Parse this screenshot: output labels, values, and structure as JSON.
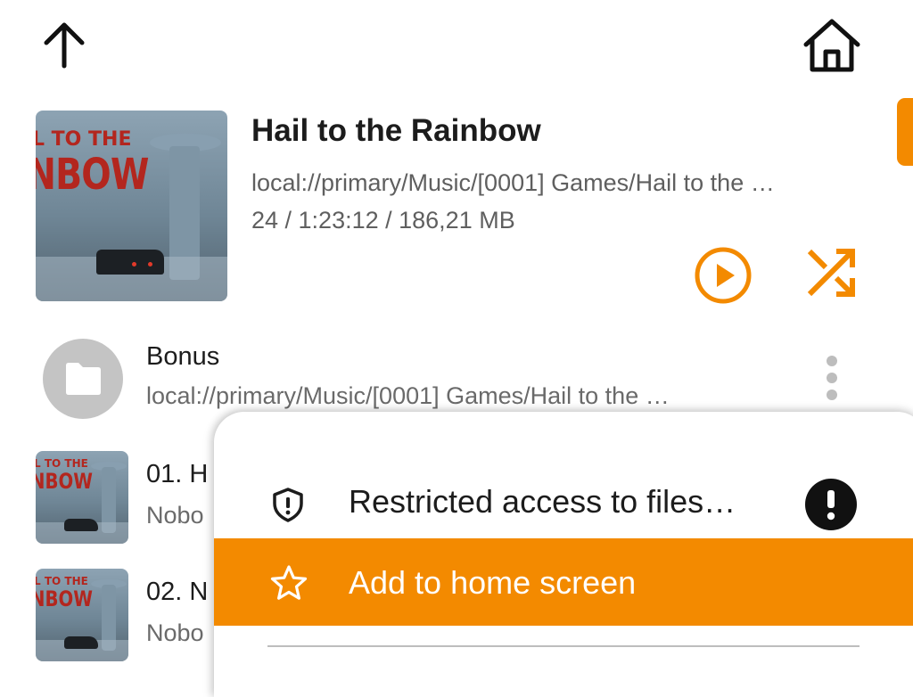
{
  "colors": {
    "accent": "#f38a00",
    "folder_avatar": "#c4c4c4"
  },
  "toolbar": {
    "up_icon": "arrow-up-icon",
    "home_icon": "home-icon"
  },
  "album": {
    "title": "Hail to the Rainbow",
    "path": "local://primary/Music/[0001] Games/Hail to the …",
    "info": "24 / 1:23:12 / 186,21 MB",
    "art_text_line1": "L TO THE",
    "art_text_line2": "NBOW"
  },
  "items": [
    {
      "type": "folder",
      "name": "Bonus",
      "path": "local://primary/Music/[0001] Games/Hail to the  …",
      "icon": "folder-icon"
    },
    {
      "type": "track",
      "title": "01. H",
      "artist": "Nobo",
      "art_text_line1": "L TO THE",
      "art_text_line2": "NBOW"
    },
    {
      "type": "track",
      "title": "02. N",
      "artist": "Nobo",
      "art_text_line1": "L TO THE",
      "art_text_line2": "NBOW"
    }
  ],
  "menu": {
    "items": [
      {
        "label": "Restricted access to files…",
        "icon": "shield-icon",
        "badge_icon": "warning-icon",
        "highlighted": false
      },
      {
        "label": "Add to home screen",
        "icon": "star-icon",
        "highlighted": true
      }
    ]
  }
}
